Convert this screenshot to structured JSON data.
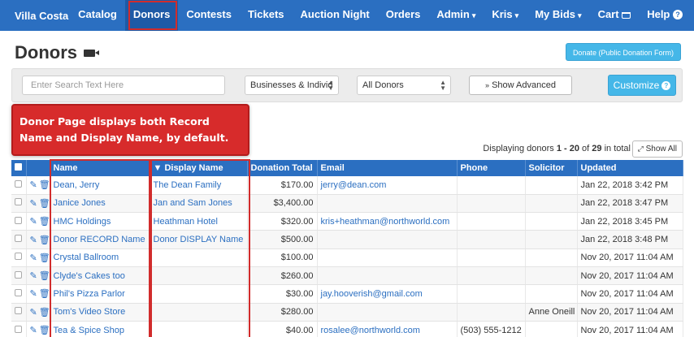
{
  "navbar": {
    "brand": "Villa Costa",
    "items": [
      {
        "label": "Catalog"
      },
      {
        "label": "Donors",
        "active": true
      },
      {
        "label": "Contests"
      },
      {
        "label": "Tickets"
      },
      {
        "label": "Auction Night"
      },
      {
        "label": "Orders"
      },
      {
        "label": "Admin",
        "caret": "▾"
      }
    ],
    "right_items": [
      {
        "label": "Kris",
        "caret": "▾"
      },
      {
        "label": "My Bids",
        "caret": "▾"
      },
      {
        "label": "Cart",
        "icon": "cart-icon",
        "glyph": "🛒"
      },
      {
        "label": "Help",
        "icon": "help-icon",
        "glyph": "?"
      }
    ]
  },
  "page": {
    "title": "Donors",
    "donate_button": "Donate (Public Donation Form)"
  },
  "filters": {
    "search_placeholder": "Enter Search Text Here",
    "type_select": "Businesses & Individ",
    "scope_select": "All Donors",
    "show_advanced": "Show Advanced",
    "customize": "Customize"
  },
  "callout": {
    "text": "Donor Page displays both Record Name and Display Name, by default."
  },
  "results": {
    "prefix": "Displaying donors ",
    "range": "1 - 20",
    "of": " of ",
    "total": "29",
    "suffix": " in total",
    "show_all": "Show All"
  },
  "table": {
    "columns": [
      "",
      "",
      "Name",
      "▼ Display Name",
      "Donation Total",
      "Email",
      "Phone",
      "Solicitor",
      "Updated"
    ],
    "rows": [
      {
        "name": "Dean, Jerry",
        "display": "The Dean Family",
        "total": "$170.00",
        "email": "jerry@dean.com",
        "phone": "",
        "solicitor": "",
        "updated": "Jan 22, 2018 3:42 PM"
      },
      {
        "name": "Janice Jones",
        "display": "Jan and Sam Jones",
        "total": "$3,400.00",
        "email": "",
        "phone": "",
        "solicitor": "",
        "updated": "Jan 22, 2018 3:47 PM"
      },
      {
        "name": "HMC Holdings",
        "display": "Heathman Hotel",
        "total": "$320.00",
        "email": "kris+heathman@northworld.com",
        "phone": "",
        "solicitor": "",
        "updated": "Jan 22, 2018 3:45 PM"
      },
      {
        "name": "Donor RECORD Name",
        "display": "Donor DISPLAY Name",
        "total": "$500.00",
        "email": "",
        "phone": "",
        "solicitor": "",
        "updated": "Jan 22, 2018 3:48 PM"
      },
      {
        "name": "Crystal Ballroom",
        "display": "",
        "total": "$100.00",
        "email": "",
        "phone": "",
        "solicitor": "",
        "updated": "Nov 20, 2017 11:04 AM"
      },
      {
        "name": "Clyde's Cakes too",
        "display": "",
        "total": "$260.00",
        "email": "",
        "phone": "",
        "solicitor": "",
        "updated": "Nov 20, 2017 11:04 AM"
      },
      {
        "name": "Phil's Pizza Parlor",
        "display": "",
        "total": "$30.00",
        "email": "jay.hooverish@gmail.com",
        "phone": "",
        "solicitor": "",
        "updated": "Nov 20, 2017 11:04 AM"
      },
      {
        "name": "Tom's Video Store",
        "display": "",
        "total": "$280.00",
        "email": "",
        "phone": "",
        "solicitor": "Anne Oneill",
        "updated": "Nov 20, 2017 11:04 AM"
      },
      {
        "name": "Tea & Spice Shop",
        "display": "",
        "total": "$40.00",
        "email": "rosalee@northworld.com",
        "phone": "(503) 555-1212",
        "solicitor": "",
        "updated": "Nov 20, 2017 11:04 AM"
      }
    ]
  },
  "colors": {
    "navbar": "#2b6fc1",
    "accent": "#45b7e8",
    "highlight": "#d12c2c"
  }
}
